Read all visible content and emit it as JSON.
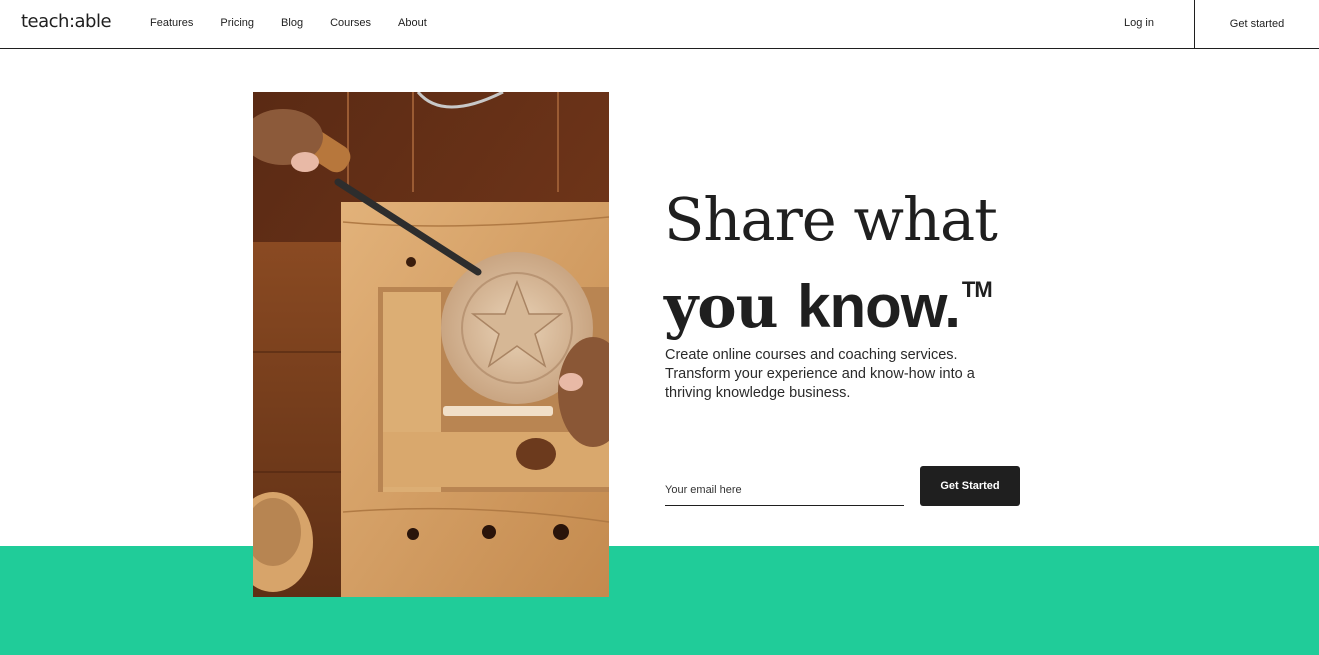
{
  "header": {
    "logo": "teach:able",
    "nav": [
      {
        "label": "Features"
      },
      {
        "label": "Pricing"
      },
      {
        "label": "Blog"
      },
      {
        "label": "Courses"
      },
      {
        "label": "About"
      }
    ],
    "login_label": "Log in",
    "get_started_label": "Get started"
  },
  "hero": {
    "headline_line1": "Share what",
    "headline_you": "you",
    "headline_know": "know.",
    "headline_tm": "TM",
    "subtext": "Create online courses and coaching services. Transform your experience and know-how into a thriving knowledge business.",
    "email_placeholder": "Your email here",
    "email_value": "",
    "cta_label": "Get Started"
  },
  "colors": {
    "accent_green": "#20cc99",
    "dark": "#1f1f1f"
  }
}
